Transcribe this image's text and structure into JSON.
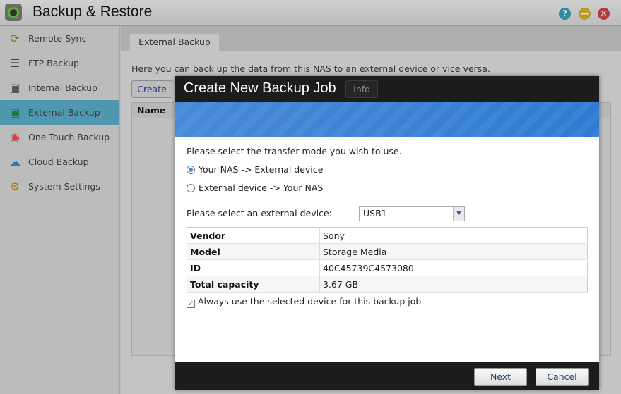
{
  "app": {
    "title": "Backup & Restore",
    "help": "?",
    "minimize": "—",
    "close": "✕"
  },
  "sidebar": {
    "items": [
      {
        "label": "Remote Sync",
        "icon": "sync-icon"
      },
      {
        "label": "FTP Backup",
        "icon": "ftp-icon"
      },
      {
        "label": "Internal Backup",
        "icon": "internal-drive-icon"
      },
      {
        "label": "External Backup",
        "icon": "external-drive-icon",
        "active": true
      },
      {
        "label": "One Touch Backup",
        "icon": "one-touch-icon"
      },
      {
        "label": "Cloud Backup",
        "icon": "cloud-icon"
      },
      {
        "label": "System Settings",
        "icon": "gear-icon"
      }
    ]
  },
  "main": {
    "tab": "External Backup",
    "description": "Here you can back up the data from this NAS to an external device or vice versa.",
    "create_label": "Create",
    "info_label": "Info",
    "grid_header": "Name"
  },
  "dialog": {
    "title": "Create New Backup Job",
    "prompt": "Please select the transfer mode you wish to use.",
    "mode_options": [
      "Your NAS -> External device",
      "External device -> Your NAS"
    ],
    "device_label": "Please select an external device:",
    "device_value": "USB1",
    "table": [
      [
        "Vendor",
        "Sony"
      ],
      [
        "Model",
        "Storage Media"
      ],
      [
        "ID",
        "40C45739C4573080"
      ],
      [
        "Total capacity",
        "3.67 GB"
      ]
    ],
    "always_use_label": "Always use the selected device for this backup job",
    "always_use_checked": true,
    "next_label": "Next",
    "cancel_label": "Cancel"
  }
}
